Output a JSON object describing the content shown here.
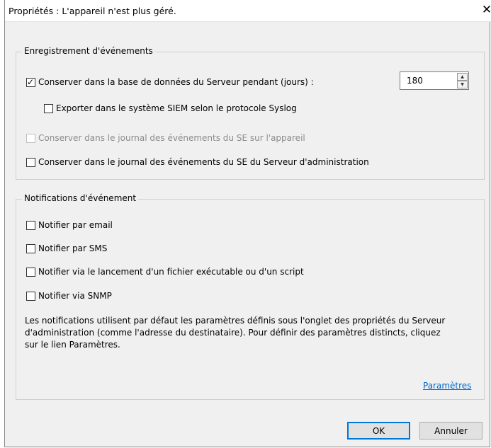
{
  "window": {
    "title": "Propriétés : L'appareil n'est plus géré."
  },
  "events_group": {
    "caption": "Enregistrement d'événements",
    "keep_db": {
      "label": "Conserver dans la base de données du Serveur pendant (jours) :",
      "checked": true
    },
    "days": {
      "value": "180"
    },
    "export_siem": {
      "label": "Exporter dans le système SIEM selon le protocole Syslog",
      "checked": false
    },
    "keep_os_log_device": {
      "label": "Conserver dans le journal des événements du SE sur l'appareil",
      "checked": false,
      "disabled": true
    },
    "keep_os_log_server": {
      "label": "Conserver dans le journal des événements du SE du Serveur d'administration",
      "checked": false
    }
  },
  "notify_group": {
    "caption": "Notifications d'événement",
    "email": {
      "label": "Notifier par email",
      "checked": false
    },
    "sms": {
      "label": "Notifier par SMS",
      "checked": false
    },
    "exec": {
      "label": "Notifier via le lancement d'un fichier exécutable ou d'un script",
      "checked": false
    },
    "snmp": {
      "label": "Notifier via SNMP",
      "checked": false
    },
    "info_line1": "Les notifications utilisent par défaut les paramètres définis sous l'onglet des propriétés du Serveur",
    "info_line2": "d'administration (comme l'adresse du destinataire). Pour définir des paramètres distincts, cliquez",
    "info_line3": "sur le lien Paramètres.",
    "settings_link": "Paramètres"
  },
  "buttons": {
    "ok": "OK",
    "cancel": "Annuler"
  },
  "colors": {
    "link": "#0066cc",
    "default_button_border": "#0078d7",
    "dialog_bg": "#f0f0f0"
  }
}
